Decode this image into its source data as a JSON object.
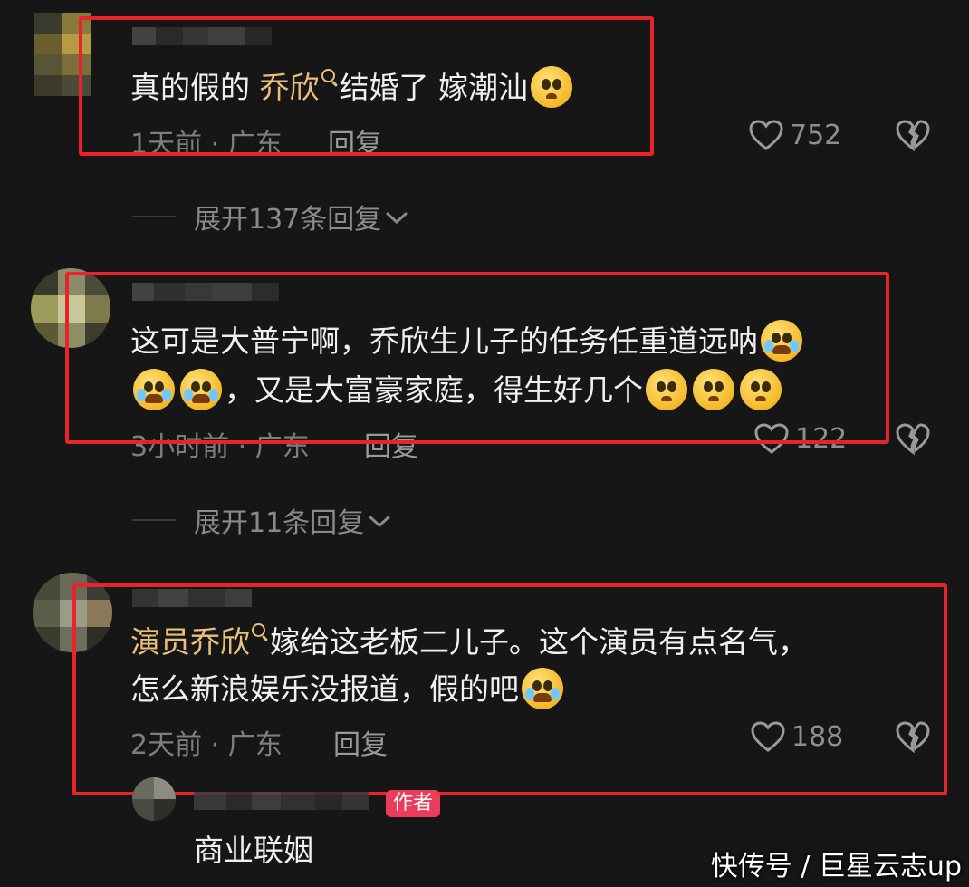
{
  "comments": [
    {
      "text_pre": "真的假的 ",
      "highlight": "乔欣",
      "text_post": "结婚了 嫁潮汕",
      "time": "1天前 · 广东",
      "reply": "回复",
      "likes": "752"
    },
    {
      "line1": "这可是大普宁啊，乔欣生儿子的任务任重道远呐",
      "line2": "，又是大富豪家庭，得生好几个",
      "time": "3小时前 · 广东",
      "reply": "回复",
      "likes": "122"
    },
    {
      "highlight": "演员乔欣",
      "line1": "嫁给这老板二儿子。这个演员有点名气，",
      "line2": "怎么新浪娱乐没报道，假的吧",
      "time": "2天前 · 广东",
      "reply": "回复",
      "likes": "188"
    }
  ],
  "expand_1": "展开137条回复",
  "expand_2": "展开11条回复",
  "reply_comment": {
    "badge": "作者",
    "text": "商业联姻"
  },
  "watermark": "快传号 / 巨星云志up",
  "icons": {
    "like": "heart-outline-icon",
    "dislike": "broken-heart-icon",
    "expand": "chevron-down-icon",
    "search": "search-icon"
  },
  "colors": {
    "background": "#161616",
    "highlight": "#e9c07a",
    "annotation_box": "#e8232a",
    "author_badge": "#ea3d5c"
  }
}
